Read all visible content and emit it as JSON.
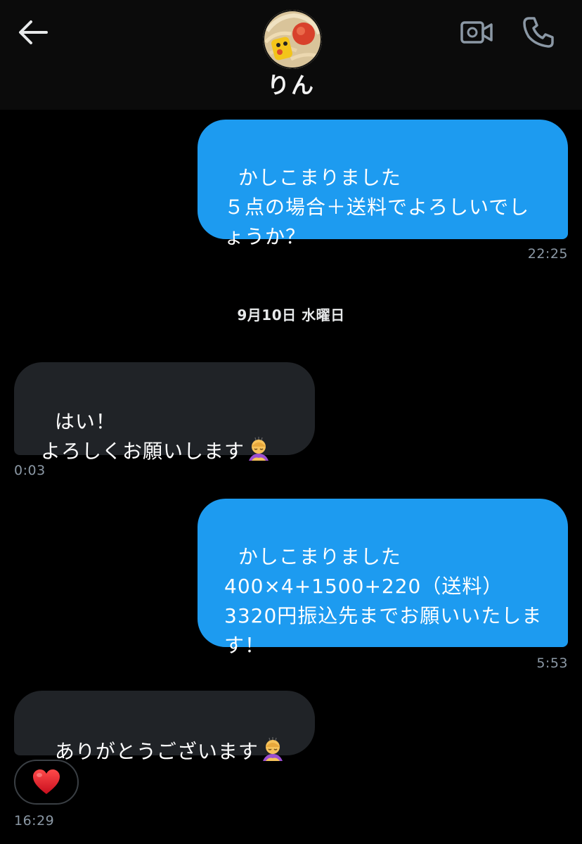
{
  "header": {
    "contact_name": "りん",
    "back_icon": "arrow-left-icon",
    "video_icon": "video-call-icon",
    "phone_icon": "phone-icon"
  },
  "messages": [
    {
      "direction": "outgoing",
      "text": "かしこまりました\n５点の場合＋送料でよろしいでしょうか？",
      "time": "22:25"
    },
    {
      "direction": "incoming",
      "text": "はい！\nよろしくお願いします",
      "emoji": "person-bowing-emoji",
      "time": "0:03"
    },
    {
      "direction": "outgoing",
      "text": "かしこまりました\n400×4+1500+220（送料）\n3320円振込先までお願いいたします！",
      "time": "5:53"
    },
    {
      "direction": "incoming",
      "text": "ありがとうございます",
      "emoji": "person-bowing-emoji",
      "reaction": "heart-emoji",
      "time": "16:29"
    }
  ],
  "date_separator": "9月10日 水曜日",
  "colors": {
    "outgoing_bubble": "#1d9bf0",
    "incoming_bubble": "#202327",
    "background": "#000000",
    "timestamp": "#8b98a5"
  }
}
